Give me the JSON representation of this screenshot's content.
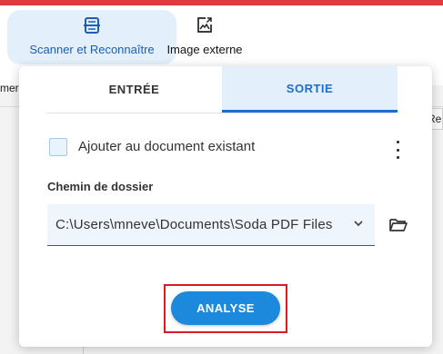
{
  "toolbar": {
    "scan_label": "Scanner et Reconnaître",
    "scan_icon": "scanner-icon",
    "external_label": "Image externe",
    "external_icon": "image-icon"
  },
  "background": {
    "left_fragment": "mer",
    "right_fragment": "Re"
  },
  "popup": {
    "tabs": [
      {
        "label": "ENTRÉE",
        "active": false
      },
      {
        "label": "SORTIE",
        "active": true
      }
    ],
    "checkbox": {
      "label": "Ajouter au document existant",
      "checked": false
    },
    "more_icon": "more-vertical-icon",
    "folder": {
      "label": "Chemin de dossier",
      "value": "C:\\Users\\mneve\\Documents\\Soda PDF Files",
      "dropdown_icon": "chevron-down-icon",
      "browse_icon": "folder-open-icon"
    },
    "action_label": "ANALYSE"
  },
  "colors": {
    "accent": "#1d89dd",
    "active_tab_bg": "#e3f0fc",
    "highlight": "#d81c25",
    "top_strip": "#e0393e"
  }
}
